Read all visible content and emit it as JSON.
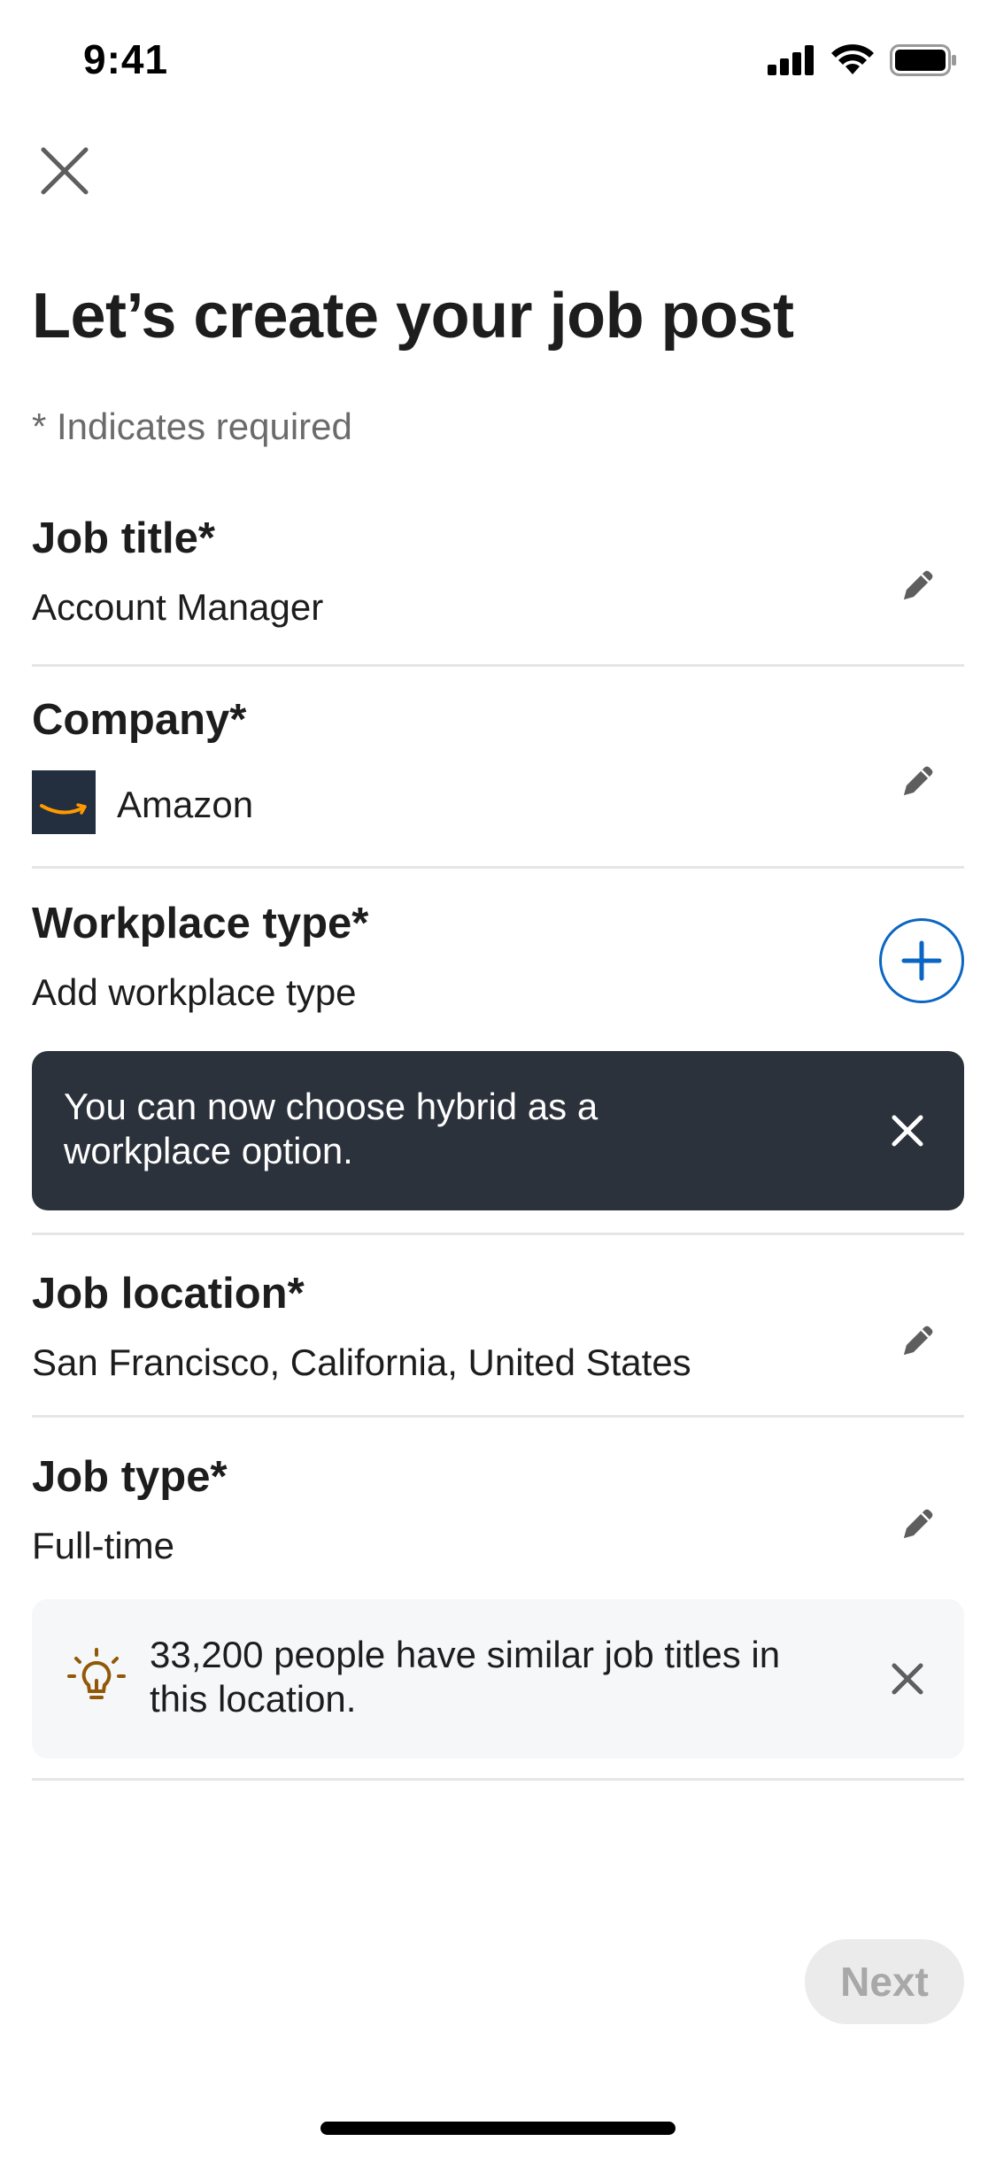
{
  "status_bar": {
    "time": "9:41"
  },
  "header": {
    "title": "Let’s create your job post",
    "required_note": "* Indicates required"
  },
  "fields": {
    "job_title": {
      "label": "Job title*",
      "value": "Account Manager"
    },
    "company": {
      "label": "Company*",
      "value": "Amazon"
    },
    "workplace_type": {
      "label": "Workplace type*",
      "value": "Add workplace type"
    },
    "job_location": {
      "label": "Job location*",
      "value": "San Francisco, California, United States"
    },
    "job_type": {
      "label": "Job type*",
      "value": "Full-time"
    }
  },
  "hybrid_tip": {
    "text": "You can now choose hybrid as a workplace option."
  },
  "insight": {
    "text": "33,200 people have similar job titles in this location."
  },
  "footer": {
    "next_label": "Next"
  },
  "colors": {
    "accent": "#0a66c2",
    "tooltip_bg": "#2c323b",
    "insight_bg": "#f6f7f9",
    "bulb": "#915907",
    "amazon_logo_bg": "#232f3e",
    "amazon_smile": "#ff9900"
  },
  "icons": {
    "close": "close-icon",
    "edit": "pencil-icon",
    "add": "plus-icon",
    "insight": "lightbulb-icon"
  }
}
